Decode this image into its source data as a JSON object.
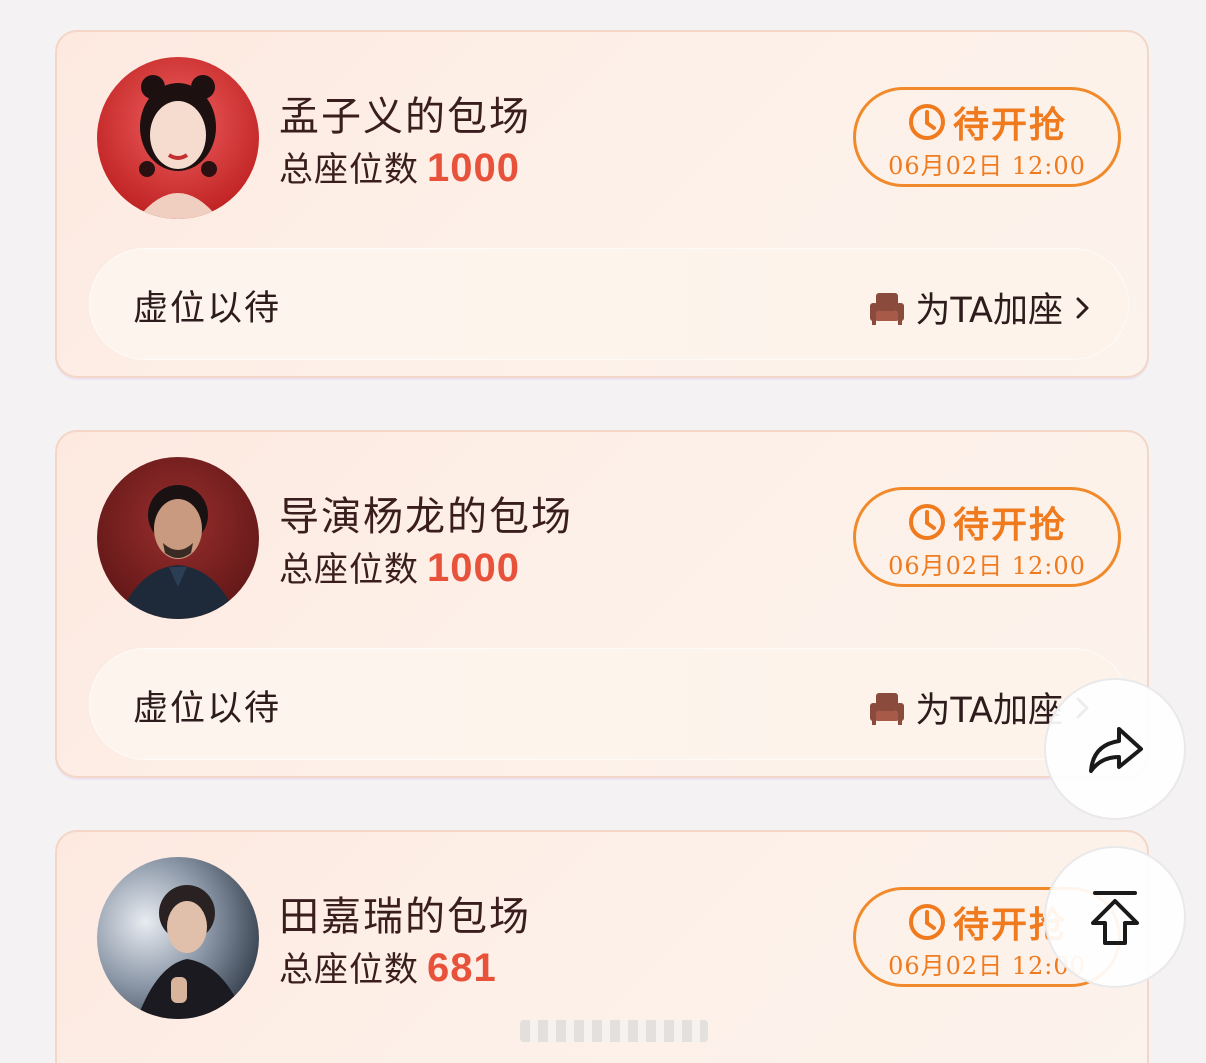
{
  "cards": [
    {
      "title": "孟子义的包场",
      "seats_label": "总座位数",
      "seats_count": "1000",
      "rush_label": "待开抢",
      "rush_time": "06月02日 12:00",
      "seat_bar_label": "虚位以待",
      "add_seat_label": "为TA加座"
    },
    {
      "title": "导演杨龙的包场",
      "seats_label": "总座位数",
      "seats_count": "1000",
      "rush_label": "待开抢",
      "rush_time": "06月02日 12:00",
      "seat_bar_label": "虚位以待",
      "add_seat_label": "为TA加座"
    },
    {
      "title": "田嘉瑞的包场",
      "seats_label": "总座位数",
      "seats_count": "681",
      "rush_label": "待开抢",
      "rush_time": "06月02日 12:00",
      "seat_bar_label": "",
      "add_seat_label": ""
    }
  ],
  "icons": {
    "clock": "clock-icon",
    "sofa": "sofa-icon",
    "chevron": "chevron-right-icon",
    "share": "share-icon",
    "back_to_top": "back-to-top-icon"
  },
  "colors": {
    "accent_orange": "#f07a1e",
    "seat_count_red": "#e8523a",
    "text_dark": "#3a1e1e",
    "card_bg": "#fdece3"
  }
}
